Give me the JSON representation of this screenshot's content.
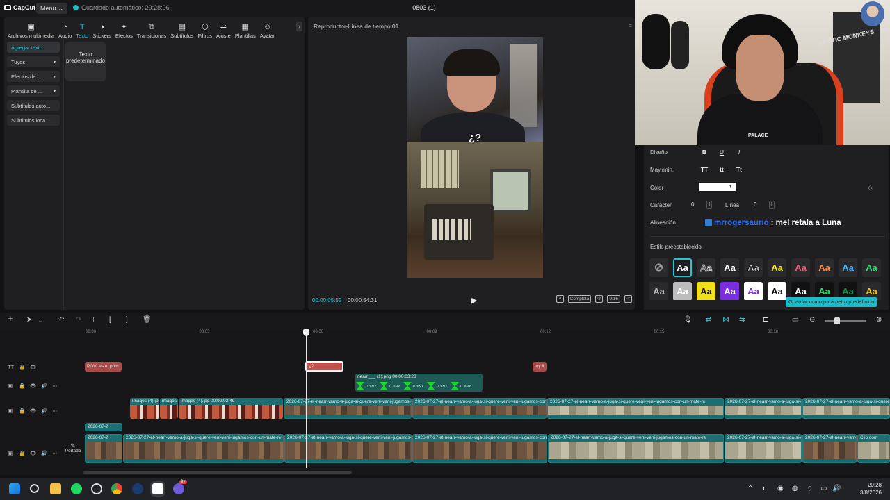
{
  "topbar": {
    "logo": "CapCut",
    "menu": "Menú",
    "autosave": "Guardado automático: 20:28:06",
    "project_title": "0803 (1)"
  },
  "toolbar": {
    "items": [
      {
        "label": "Archivos multimedia",
        "icon": "media-icon"
      },
      {
        "label": "Audio",
        "icon": "audio-icon"
      },
      {
        "label": "Texto",
        "icon": "text-icon"
      },
      {
        "label": "Stickers",
        "icon": "sticker-icon"
      },
      {
        "label": "Efectos",
        "icon": "effects-icon"
      },
      {
        "label": "Transiciones",
        "icon": "transitions-icon"
      },
      {
        "label": "Subtítulos",
        "icon": "subtitles-icon"
      },
      {
        "label": "Filtros",
        "icon": "filters-icon"
      },
      {
        "label": "Ajuste",
        "icon": "adjust-icon"
      },
      {
        "label": "Plantillas",
        "icon": "templates-icon"
      },
      {
        "label": "Avatar",
        "icon": "avatar-icon"
      }
    ],
    "active": "Texto"
  },
  "sidenav": {
    "items": [
      "Agregar texto",
      "Tuyos",
      "Efectos de t...",
      "Plantilla de ...",
      "Subtítulos auto...",
      "Subtítulos loca..."
    ]
  },
  "template_card": {
    "label": "Texto predeterminado"
  },
  "player": {
    "title": "Reproductor-Línea de tiempo 01",
    "caption": "¿?",
    "current_time": "00:00:05:52",
    "total_time": "00:00:54:31",
    "view_mode": "Completa",
    "ratio": "9:16"
  },
  "properties": {
    "design_label": "Diseño",
    "design_options": [
      "B",
      "U",
      "I"
    ],
    "case_label": "May./min.",
    "case_options": [
      "TT",
      "tt",
      "Tt"
    ],
    "color_label": "Color",
    "color_value": "#ffffff",
    "char_label": "Carácter",
    "char_value": "0",
    "line_label": "Línea",
    "line_value": "0",
    "align_label": "Alineación",
    "overlay_user": "mrrogersaurio",
    "overlay_text": ": mel retala a Luna",
    "preset_label": "Estilo preestablecido",
    "save_preset": "Guardar como parámetro predefinido",
    "preset_sample": "Aa"
  },
  "timeline": {
    "ticks": [
      "00:00",
      "00:03",
      "00:06",
      "00:09",
      "00:12",
      "00:15",
      "00:18"
    ],
    "text_clips": [
      "POV: es tu prim",
      "¿?",
      "toy li"
    ],
    "sticker_clip": "nearr___ (1).png  00:00:03:23",
    "sticker_label": "n_exrv",
    "image_clips": [
      "images (4).jpg",
      "images",
      "images (4).jpg  00:00:02:49"
    ],
    "video_clip_name": "2026-07-27-el-nearr-vamo-a-juga-si-quere-veni-veni-jugamos-con-un-mate-re",
    "short_clip": "2026-07-2",
    "clip_comp": "Clip com",
    "cover_label": "Portada"
  },
  "taskbar": {
    "time": "20:28",
    "date": "3/8/2026",
    "badge": "9+"
  },
  "webcam": {
    "poster_text": "ARCTIC MONKEYS",
    "hoodie_text": "PALACE"
  }
}
